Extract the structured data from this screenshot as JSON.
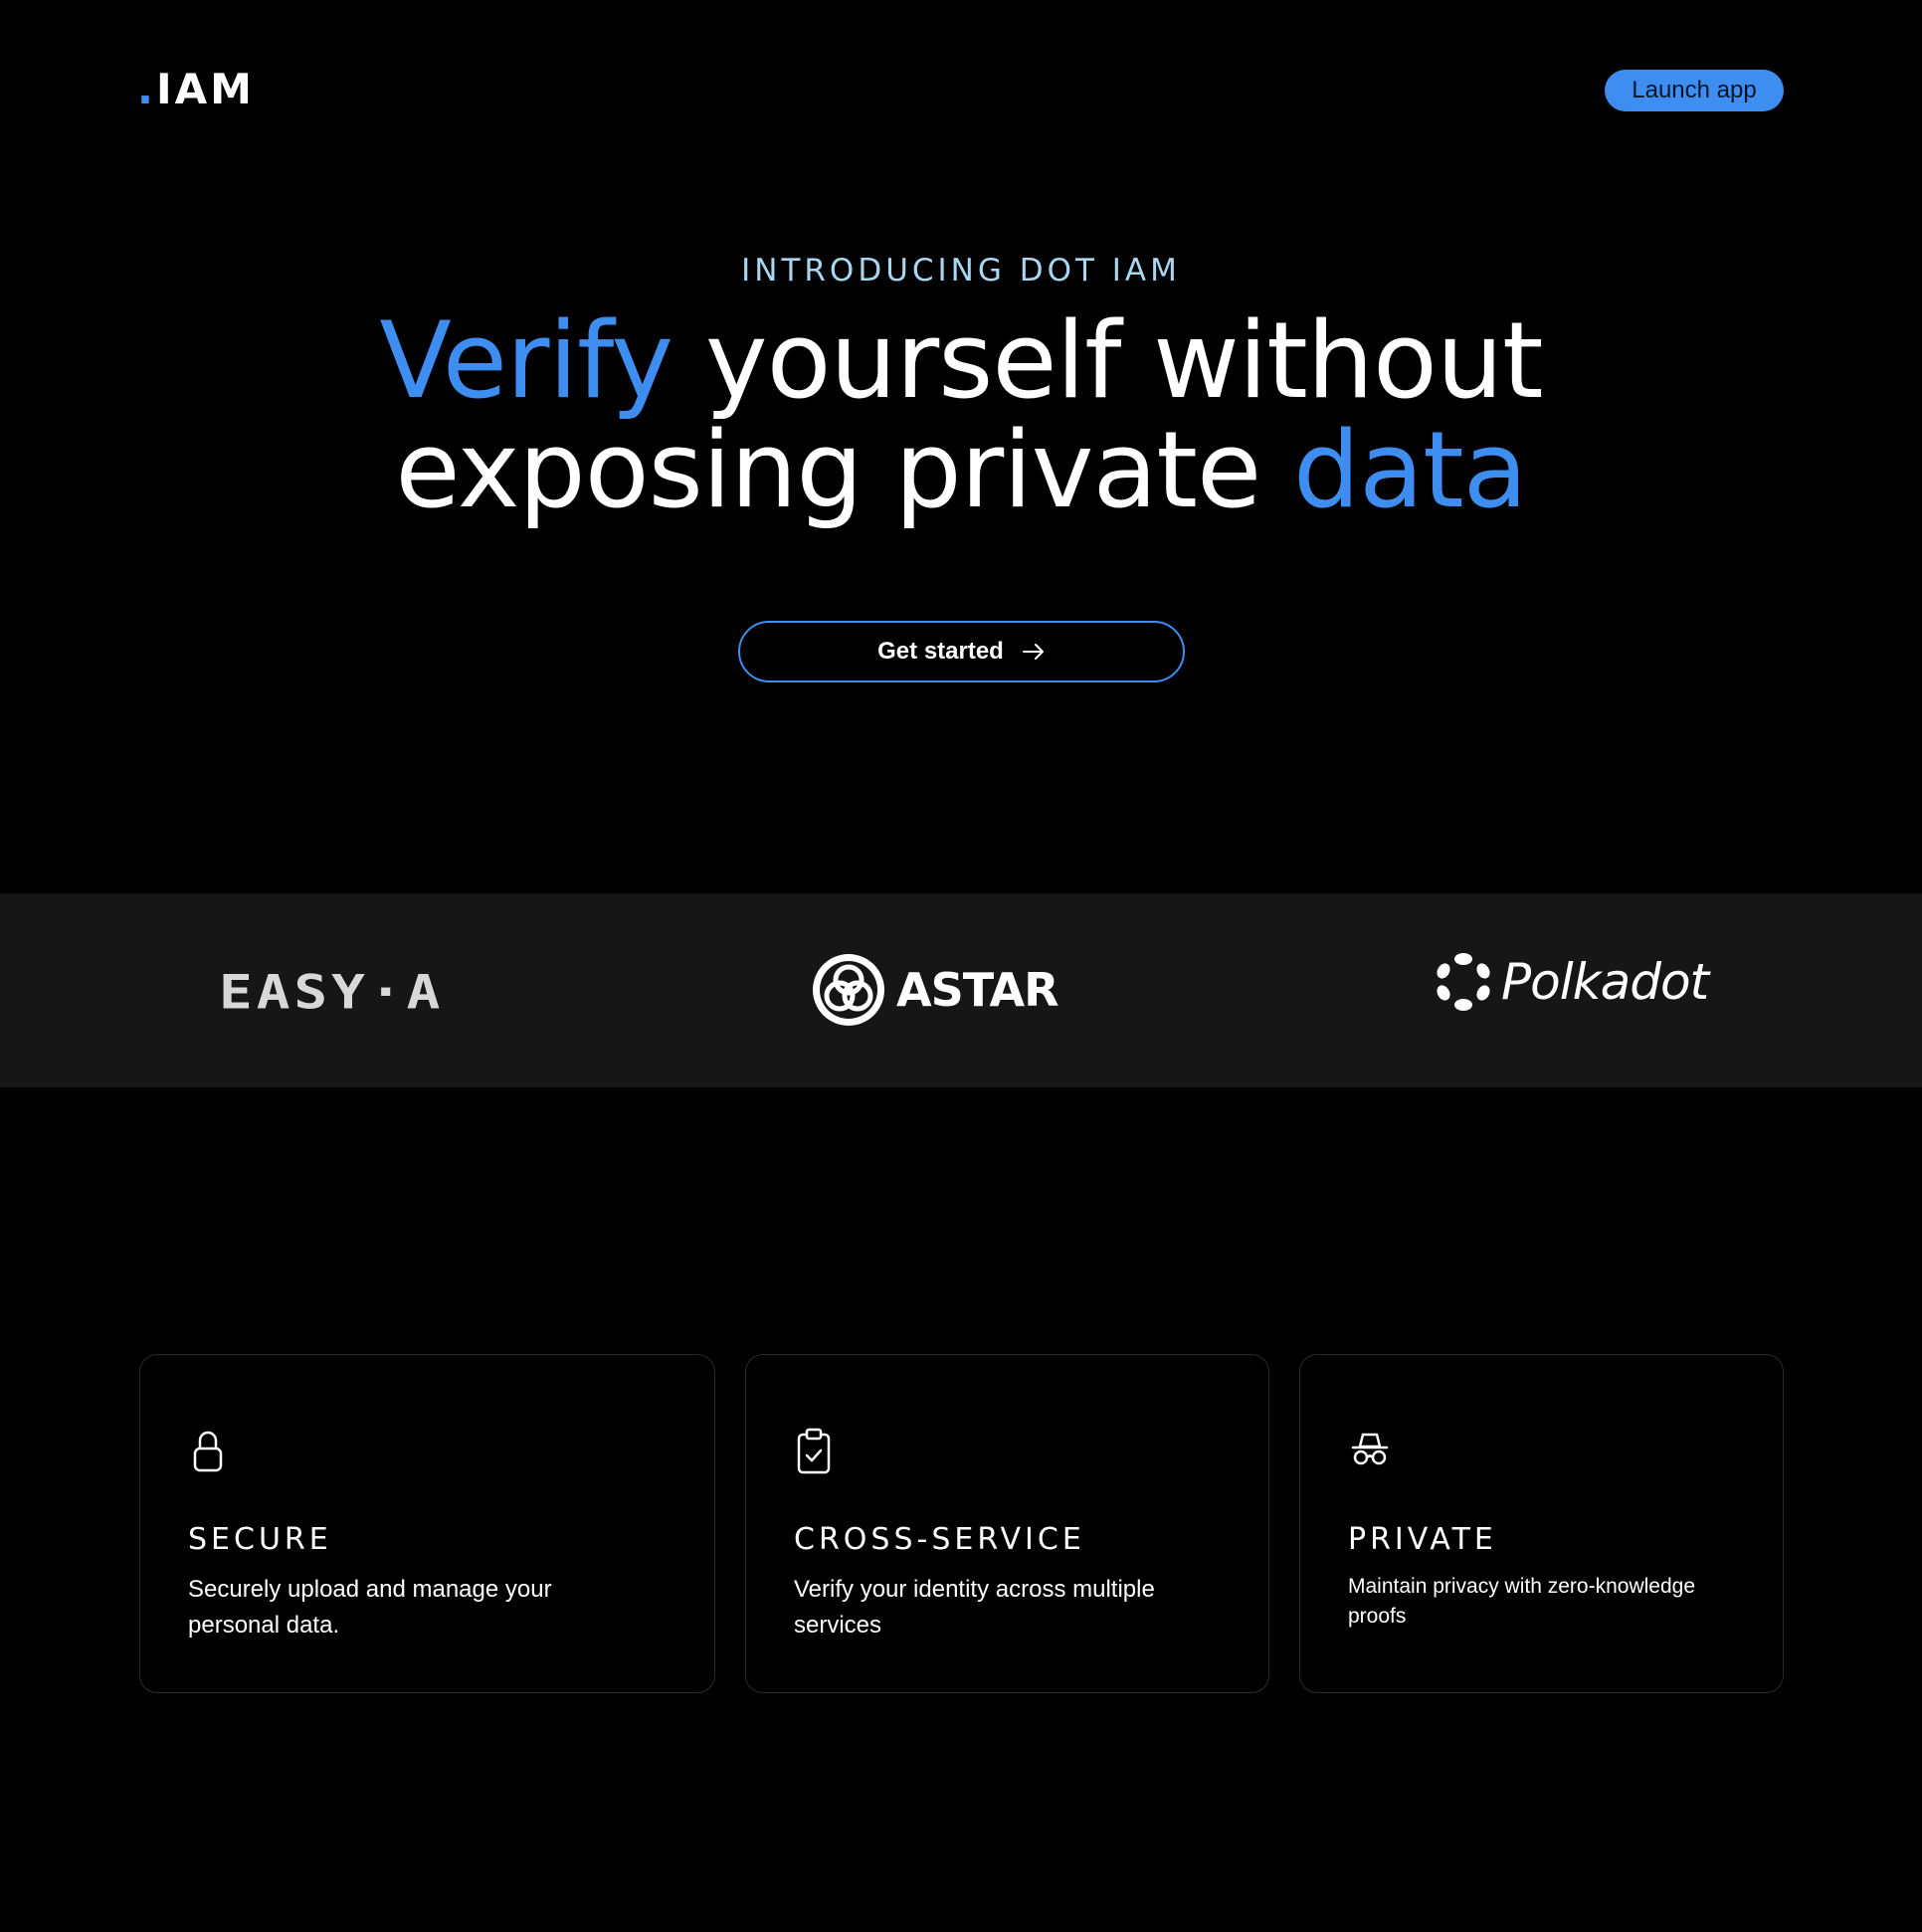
{
  "header": {
    "logo_dot": ".",
    "logo_text": "IAM",
    "launch_label": "Launch app"
  },
  "hero": {
    "eyebrow": "INTRODUCING DOT IAM",
    "headline_accent_1": "Verify",
    "headline_part_1": " yourself without",
    "headline_part_2": "exposing private ",
    "headline_accent_2": "data",
    "cta_label": "Get started",
    "cta_icon": "arrow-right-icon"
  },
  "partners": [
    {
      "name": "EASY·A",
      "icon": "easya-logo"
    },
    {
      "name": "ASTAR",
      "icon": "astar-logo"
    },
    {
      "name": "Polkadot",
      "icon": "polkadot-logo"
    }
  ],
  "features": [
    {
      "icon": "lock-icon",
      "title": "SECURE",
      "description": "Securely upload and manage your personal data."
    },
    {
      "icon": "clipboard-check-icon",
      "title": "CROSS-SERVICE",
      "description": "Verify your identity across multiple services"
    },
    {
      "icon": "incognito-icon",
      "title": "PRIVATE",
      "description": "Maintain privacy with zero-knowledge proofs"
    }
  ],
  "colors": {
    "background": "#000000",
    "accent": "#3d8ef0",
    "eyebrow": "#a9d7f2",
    "band": "#161616",
    "card_border": "#2a2a2a"
  }
}
